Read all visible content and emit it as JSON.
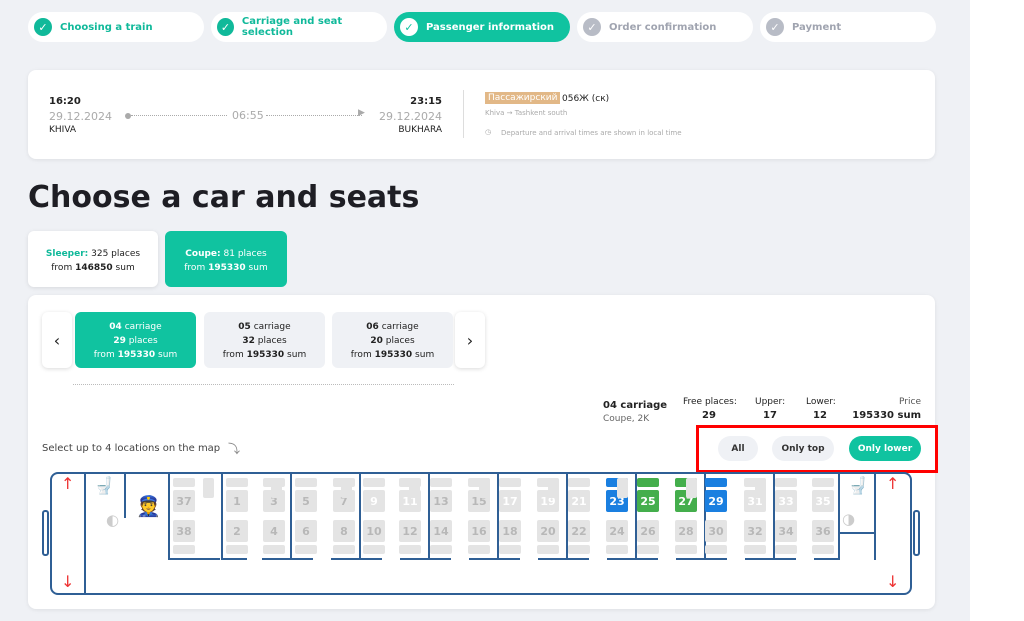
{
  "steps": [
    {
      "label": "Choosing a train",
      "state": "done"
    },
    {
      "label": "Carriage and seat selection",
      "state": "done"
    },
    {
      "label": "Passenger information",
      "state": "active"
    },
    {
      "label": "Order confirmation",
      "state": "todo"
    },
    {
      "label": "Payment",
      "state": "todo"
    }
  ],
  "trip": {
    "dep_time": "16:20",
    "dep_date": "29.12.2024",
    "dep_city": "KHIVA",
    "duration": "06:55",
    "arr_time": "23:15",
    "arr_date": "29.12.2024",
    "arr_city": "BUKHARA",
    "train_type": "Пассажирский",
    "train_no": "056Ж (ск)",
    "route": "Khiva → Tashkent south",
    "note": "Departure and arrival times are shown in local time"
  },
  "title": "Choose a car and seats",
  "class_tabs": [
    {
      "name": "Sleeper:",
      "places": "325 places",
      "from": "from",
      "price": "146850",
      "unit": "sum"
    },
    {
      "name": "Coupe:",
      "places": "81 places",
      "from": "from",
      "price": "195330",
      "unit": "sum"
    }
  ],
  "carriages": [
    {
      "num": "04",
      "label": "carriage",
      "places": "29",
      "places_label": "places",
      "from": "from",
      "price": "195330",
      "unit": "sum"
    },
    {
      "num": "05",
      "label": "carriage",
      "places": "32",
      "places_label": "places",
      "from": "from",
      "price": "195330",
      "unit": "sum"
    },
    {
      "num": "06",
      "label": "carriage",
      "places": "20",
      "places_label": "places",
      "from": "from",
      "price": "195330",
      "unit": "sum"
    }
  ],
  "summary": {
    "carriage": "04 carriage",
    "type": "Coupe, 2K",
    "free_label": "Free places:",
    "free": "29",
    "upper_label": "Upper:",
    "upper": "17",
    "lower_label": "Lower:",
    "lower": "12",
    "price_label": "Price",
    "price": "195330 sum"
  },
  "hint": "Select up to 4 locations on the map",
  "filters": {
    "all": "All",
    "top": "Only top",
    "lower": "Only lower",
    "active": "lower"
  },
  "colors": {
    "accent": "#10c3a0",
    "seat_blue": "#1a7fe0",
    "seat_green": "#44ae4c",
    "highlight": "#ff0000"
  },
  "seats": {
    "top": [
      [
        "37",
        "grey"
      ],
      [
        "1",
        "grey"
      ],
      [
        "3",
        "grey"
      ],
      [
        "5",
        "grey"
      ],
      [
        "7",
        "grey"
      ],
      [
        "9",
        "white"
      ],
      [
        "11",
        "white"
      ],
      [
        "13",
        "grey"
      ],
      [
        "15",
        "grey"
      ],
      [
        "17",
        "white"
      ],
      [
        "19",
        "white"
      ],
      [
        "21",
        "white"
      ],
      [
        "23",
        "blue"
      ],
      [
        "25",
        "green"
      ],
      [
        "27",
        "green"
      ],
      [
        "29",
        "blue"
      ],
      [
        "31",
        "white"
      ],
      [
        "33",
        "white"
      ],
      [
        "35",
        "white"
      ]
    ],
    "bottom": [
      "38",
      "2",
      "4",
      "6",
      "8",
      "10",
      "12",
      "14",
      "16",
      "18",
      "20",
      "22",
      "24",
      "26",
      "28",
      "30",
      "32",
      "34",
      "36"
    ]
  }
}
